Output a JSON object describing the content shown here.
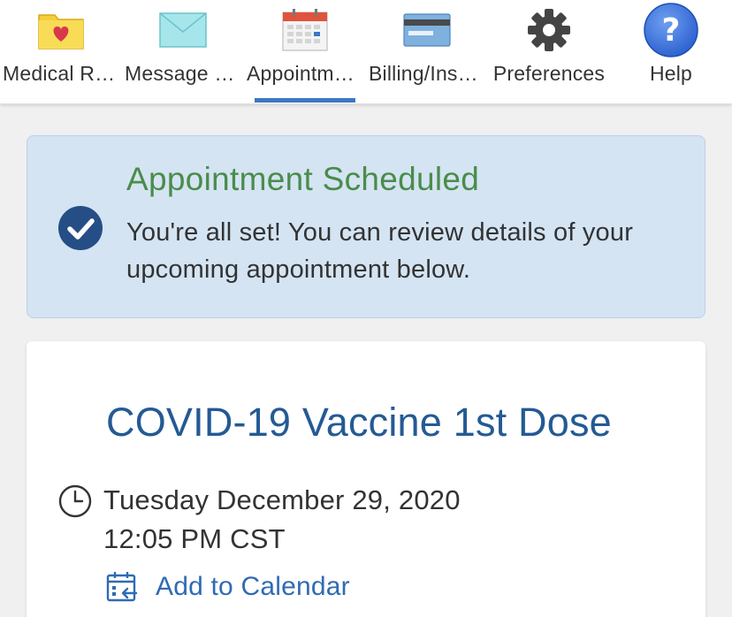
{
  "nav": {
    "items": [
      {
        "label": "Medical Records",
        "icon": "folder-heart-icon"
      },
      {
        "label": "Message Center",
        "icon": "envelope-icon"
      },
      {
        "label": "Appointments",
        "icon": "calendar-icon",
        "active": true
      },
      {
        "label": "Billing/Insurance",
        "icon": "credit-card-icon"
      },
      {
        "label": "Preferences",
        "icon": "gear-icon"
      },
      {
        "label": "Help",
        "icon": "question-icon"
      }
    ]
  },
  "banner": {
    "title": "Appointment Scheduled",
    "message": "You're all set! You can review details of your upcoming appointment below.",
    "icon": "check-circle-icon"
  },
  "appointment": {
    "title": "COVID-19 Vaccine 1st Dose",
    "date": "Tuesday December 29, 2020",
    "time": "12:05 PM CST",
    "add_to_calendar_label": "Add to Calendar"
  },
  "colors": {
    "accent": "#3b78c4",
    "success_green": "#4a8c4a",
    "banner_bg": "#d4e4f3",
    "title_blue": "#245a94",
    "link_blue": "#2f6bb3"
  }
}
